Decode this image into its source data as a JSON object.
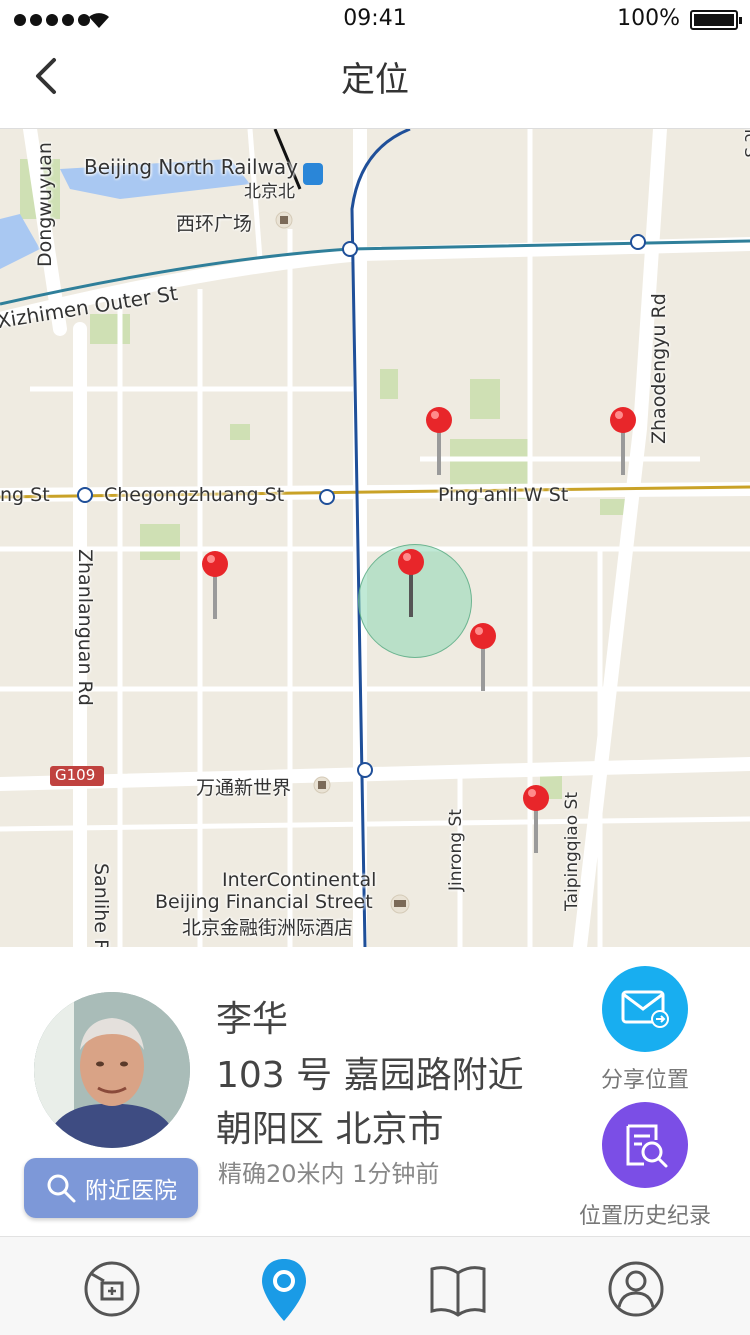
{
  "status_bar": {
    "time": "09:41",
    "battery": "100%"
  },
  "nav": {
    "title": "定位"
  },
  "map": {
    "labels": {
      "railway_en": "Beijing North Railway",
      "railway_cn": "北京北",
      "xihuan": "西环广场",
      "dongwuyuan": "Dongwuyuan",
      "xizhimen": "Xizhimen Outer St",
      "chegong": "Chegongzhuang St",
      "chegong_left": "ng St",
      "pinganli": "Ping'anli W St",
      "zhaodengyu": "Zhaodengyu Rd",
      "zhanlanguan": "Zhanlanguan Rd",
      "g109": "G109",
      "wantong": "万通新世界",
      "jinrong": "Jinrong St",
      "taipingqiao": "Taipingqiao St",
      "sanlihe": "Sanlihe R",
      "ic1": "InterContinental",
      "ic2": "Beijing Financial Street",
      "ic3": "北京金融街洲际酒店",
      "right_edge": "ic S"
    }
  },
  "person": {
    "name": "李华",
    "address_line1": "103 号 嘉园路附近",
    "address_line2": "朝阳区 北京市",
    "accuracy": "精确20米内 1分钟前"
  },
  "buttons": {
    "nearby_hospital": "附近医院",
    "share_location": "分享位置",
    "location_history": "位置历史纪录"
  },
  "colors": {
    "share": "#18aef0",
    "history": "#7b4ee6",
    "nearby": "#7d98d8",
    "active_tab": "#1a9be6"
  },
  "tabs": [
    "health-icon",
    "location-icon",
    "book-icon",
    "profile-icon"
  ]
}
